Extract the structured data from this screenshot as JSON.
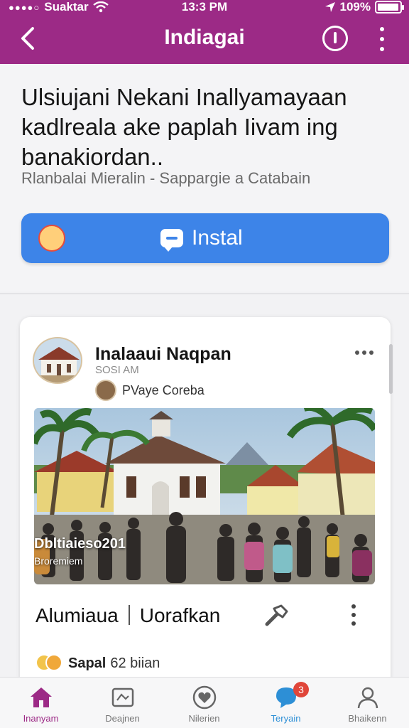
{
  "status_bar": {
    "carrier": "Suaktar",
    "time": "13:3 PM",
    "battery": "109%",
    "battery_level": 0.95
  },
  "app_bar": {
    "title": "Indiagai"
  },
  "intro": {
    "headline": "Ulsiujani Nekani Inallyamayaan kadlreala ake paplah Iivam ing banakiordan..",
    "subline": "Rlanbalai Mieralin - Sappargie a Catabain",
    "install_label": "Instal"
  },
  "post": {
    "author": "Inalaaui Naqpan",
    "time": "SOSI AM",
    "location": "PVaye Coreba",
    "photo_caption_title": "Dbltiaieso201",
    "photo_caption_sub": "Broremiem",
    "action_like": "Alumiaua",
    "action_comment": "Uorafkan",
    "reactions_name": "Sapal",
    "reactions_count": "62 biian"
  },
  "bottom_nav": [
    {
      "label": "Inanyam"
    },
    {
      "label": "Deajnen"
    },
    {
      "label": "Nilerien"
    },
    {
      "label": "Teryain",
      "badge": "3"
    },
    {
      "label": "Bhaikenn"
    }
  ],
  "colors": {
    "brand": "#9c2a86",
    "install": "#3d84e8",
    "badge": "#e0463a"
  }
}
